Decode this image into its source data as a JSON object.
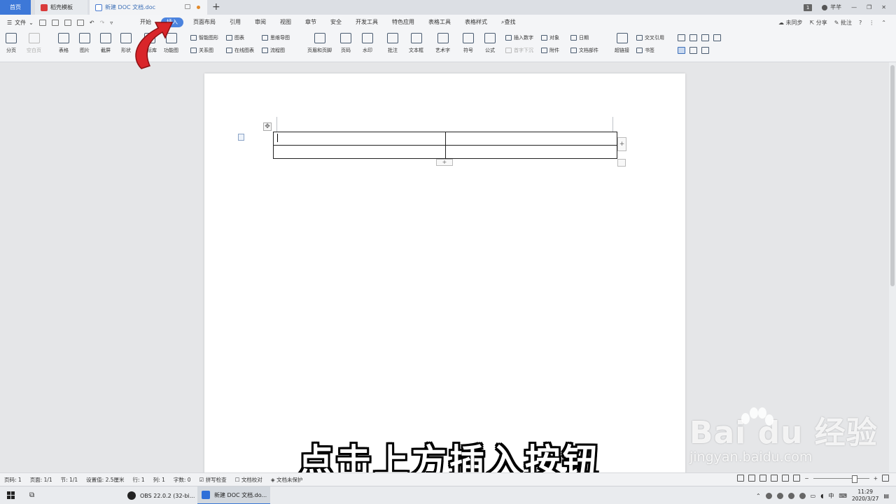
{
  "tabs": {
    "home": "首页",
    "template": "稻壳模板",
    "doc": "新建 DOC 文档.doc",
    "add": "+"
  },
  "titlebar": {
    "badge": "1",
    "user": "芊芊"
  },
  "menubar": {
    "file": "文件",
    "items": [
      "开始",
      "插入",
      "页面布局",
      "引用",
      "审阅",
      "视图",
      "章节",
      "安全",
      "开发工具",
      "特色应用",
      "表格工具",
      "表格样式"
    ],
    "search": "查找",
    "right": {
      "sync": "未同步",
      "share": "分享",
      "comment": "批注",
      "help": "?"
    }
  },
  "ribbon": {
    "pagebreak": "分页",
    "blankpage": "空白页",
    "table": "表格",
    "picture": "图片",
    "screenshot": "截屏",
    "shape": "形状",
    "iconlib": "图标库",
    "funcchart": "功能图",
    "smartart": "智能图形",
    "chart": "图表",
    "mindmap": "思维导图",
    "relation": "关系图",
    "onlinechart": "在线图表",
    "flowchart": "流程图",
    "headerfooter": "页眉和页脚",
    "pagenum": "页码",
    "watermark": "水印",
    "comment": "批注",
    "textbox": "文本框",
    "wordart": "艺术字",
    "symbol": "符号",
    "formula": "公式",
    "insertnum": "插入数字",
    "dropcap": "首字下沉",
    "object": "对象",
    "attachment": "附件",
    "date": "日期",
    "docparts": "文档部件",
    "hyperlink": "超链接",
    "crossref": "交叉引用",
    "bookmark": "书签"
  },
  "table": {
    "rows": [
      [
        "",
        ""
      ],
      [
        "",
        ""
      ]
    ],
    "move_handle": "✥",
    "add_col": "+",
    "add_row": "+"
  },
  "subtitle": "点击上方插入按钮",
  "watermark": {
    "logo": "Bai du 经验",
    "url": "jingyan.baidu.com"
  },
  "statusbar": {
    "page": "页码: 1",
    "pages": "页面: 1/1",
    "section": "节: 1/1",
    "setting": "设置值: 2.5厘米",
    "row": "行: 1",
    "col": "列: 1",
    "words": "字数: 0",
    "spell": "拼写检查",
    "proof": "文档校对",
    "protect": "文档未保护"
  },
  "taskbar": {
    "obs": "OBS 22.0.2 (32-bi...",
    "wps": "新建 DOC 文档.do...",
    "ime": "中",
    "time": "11:29",
    "date": "2020/3/27"
  },
  "colors": {
    "accent": "#3d78d8",
    "arrow": "#d9252a"
  }
}
